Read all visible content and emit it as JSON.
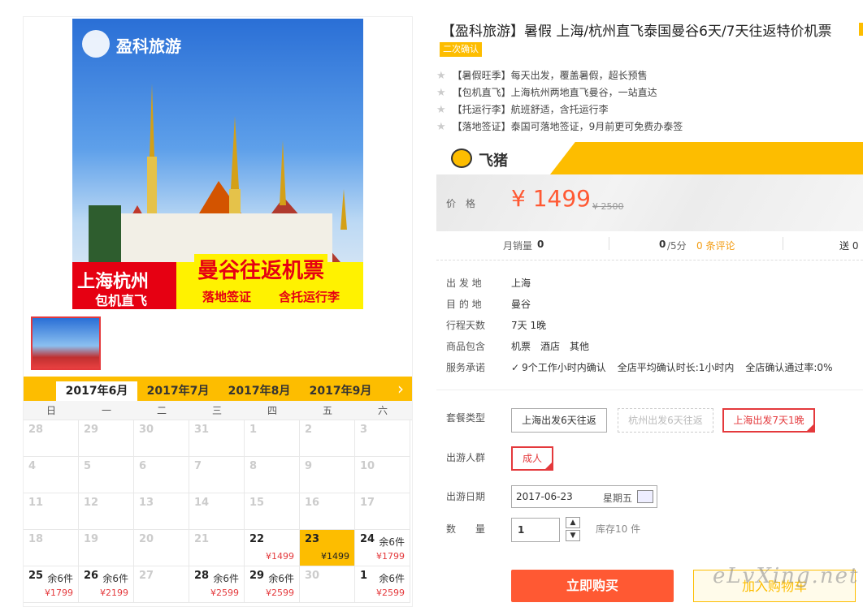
{
  "gallery": {
    "brand_logo_text": "盈科旅游",
    "banner_left_title": "上海杭州",
    "banner_left_sub": "包机直飞",
    "banner_right_title": "曼谷往返机票",
    "banner_right_sub1": "落地签证",
    "banner_right_sub2": "含托运行李"
  },
  "calendar": {
    "months": [
      "2017年6月",
      "2017年7月",
      "2017年8月",
      "2017年9月"
    ],
    "active_month": 0,
    "next_label": "›",
    "weekdays": [
      "日",
      "一",
      "二",
      "三",
      "四",
      "五",
      "六"
    ],
    "rows": [
      [
        {
          "d": "28"
        },
        {
          "d": "29"
        },
        {
          "d": "30"
        },
        {
          "d": "31"
        },
        {
          "d": "1"
        },
        {
          "d": "2"
        },
        {
          "d": "3"
        }
      ],
      [
        {
          "d": "4"
        },
        {
          "d": "5"
        },
        {
          "d": "6"
        },
        {
          "d": "7"
        },
        {
          "d": "8"
        },
        {
          "d": "9"
        },
        {
          "d": "10"
        }
      ],
      [
        {
          "d": "11"
        },
        {
          "d": "12"
        },
        {
          "d": "13"
        },
        {
          "d": "14"
        },
        {
          "d": "15"
        },
        {
          "d": "16"
        },
        {
          "d": "17"
        }
      ],
      [
        {
          "d": "18"
        },
        {
          "d": "19"
        },
        {
          "d": "20"
        },
        {
          "d": "21"
        },
        {
          "d": "22",
          "p": "¥1499",
          "av": true
        },
        {
          "d": "23",
          "p": "¥1499",
          "av": true,
          "sel": true
        },
        {
          "d": "24",
          "r": "余6件",
          "p": "¥1799",
          "av": true
        }
      ],
      [
        {
          "d": "25",
          "r": "余6件",
          "p": "¥1799",
          "av": true
        },
        {
          "d": "26",
          "r": "余6件",
          "p": "¥2199",
          "av": true
        },
        {
          "d": "27"
        },
        {
          "d": "28",
          "r": "余6件",
          "p": "¥2599",
          "av": true
        },
        {
          "d": "29",
          "r": "余6件",
          "p": "¥2599",
          "av": true
        },
        {
          "d": "30"
        },
        {
          "d": "1",
          "r": "余6件",
          "p": "¥2599",
          "av": true
        }
      ]
    ]
  },
  "product": {
    "title": "【盈科旅游】暑假 上海/杭州直飞泰国曼谷6天/7天往返特价机票",
    "tag": "二次确认",
    "highlights": [
      "【暑假旺季】每天出发，覆盖暑假，超长预售",
      "【包机直飞】上海杭州两地直飞曼谷，一站直达",
      "【托运行李】航班舒适，含托运行李",
      "【落地签证】泰国可落地签证，9月前更可免费办泰签"
    ],
    "platform": "飞猪",
    "price_label": "价　格",
    "price": "¥ 1499",
    "orig_price": "¥ 2500",
    "stats": {
      "sales_label": "月销量",
      "sales_val": "0",
      "rating_val": "0",
      "rating_suffix": "/5分",
      "reviews": "0 条评论",
      "send": "送 0"
    },
    "info": [
      {
        "label": "出 发 地",
        "value": "上海"
      },
      {
        "label": "目 的 地",
        "value": "曼谷"
      },
      {
        "label": "行程天数",
        "value": "7天 1晚"
      },
      {
        "label": "商品包含",
        "value": "机票　酒店　其他"
      }
    ],
    "service_label": "服务承诺",
    "service_items": [
      "9个工作小时内确认",
      "全店平均确认时长:1小时内",
      "全店确认通过率:0%"
    ],
    "package_label": "套餐类型",
    "packages": [
      "上海出发6天往返",
      "杭州出发6天往返",
      "上海出发7天1晚"
    ],
    "people_label": "出游人群",
    "people_option": "成人",
    "date_label": "出游日期",
    "date_value": "2017-06-23",
    "date_weekday": "星期五",
    "qty_label": "数　　量",
    "qty_value": "1",
    "stock": "库存10 件",
    "buy_label": "立即购买",
    "cart_label": "加入购物车",
    "watermark": "eLvXing.net"
  },
  "colors": {
    "accent_yellow": "#fdbd00",
    "price_red": "#ff5933",
    "select_red": "#e4393c"
  }
}
